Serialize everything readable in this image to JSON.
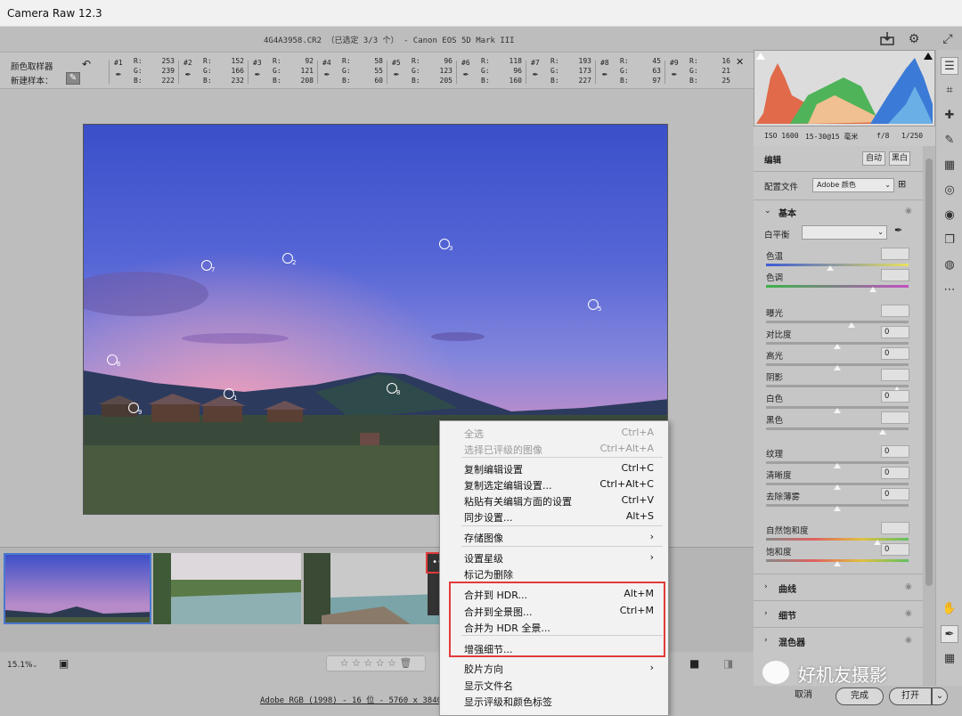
{
  "window": {
    "title": "Camera Raw 12.3"
  },
  "filebar": {
    "info": "4G4A3958.CR2 （已选定 3/3 个） - Canon EOS 5D Mark III"
  },
  "sampler": {
    "label_tool": "颜色取样器",
    "label_new": "新建样本：",
    "samples": [
      {
        "id": "#1",
        "r": "253",
        "g": "239",
        "b": "222"
      },
      {
        "id": "#2",
        "r": "152",
        "g": "166",
        "b": "232"
      },
      {
        "id": "#3",
        "r": "92",
        "g": "121",
        "b": "208"
      },
      {
        "id": "#4",
        "r": "58",
        "g": "55",
        "b": "60"
      },
      {
        "id": "#5",
        "r": "96",
        "g": "123",
        "b": "205"
      },
      {
        "id": "#6",
        "r": "118",
        "g": "96",
        "b": "160"
      },
      {
        "id": "#7",
        "r": "193",
        "g": "173",
        "b": "227"
      },
      {
        "id": "#8",
        "r": "45",
        "g": "63",
        "b": "97"
      },
      {
        "id": "#9",
        "r": "16",
        "g": "21",
        "b": "25"
      }
    ],
    "r_label": "R:",
    "g_label": "G:",
    "b_label": "B:"
  },
  "photo_markers": [
    "1",
    "2",
    "3",
    "4",
    "5",
    "6",
    "7",
    "8",
    "9"
  ],
  "exif": {
    "iso": "ISO 1600",
    "lens": "15-30@15 毫米",
    "aperture": "f/8",
    "shutter": "1/250"
  },
  "panel": {
    "edit": "编辑",
    "auto": "自动",
    "bw": "黑白",
    "profile_label": "配置文件",
    "profile_value": "Adobe 颜色",
    "basic": "基本",
    "wb_label": "白平衡",
    "sliders": [
      {
        "label": "色温",
        "value": ""
      },
      {
        "label": "色调",
        "value": ""
      },
      {
        "label": "曝光",
        "value": ""
      },
      {
        "label": "对比度",
        "value": "0"
      },
      {
        "label": "高光",
        "value": "0"
      },
      {
        "label": "阴影",
        "value": ""
      },
      {
        "label": "白色",
        "value": "0"
      },
      {
        "label": "黑色",
        "value": ""
      },
      {
        "label": "纹理",
        "value": "0"
      },
      {
        "label": "清晰度",
        "value": "0"
      },
      {
        "label": "去除薄雾",
        "value": "0"
      },
      {
        "label": "自然饱和度",
        "value": ""
      },
      {
        "label": "饱和度",
        "value": "0"
      }
    ],
    "curve": "曲线",
    "detail": "细节",
    "mixer": "混色器"
  },
  "menu": {
    "items": [
      {
        "label": "全选",
        "shortcut": "Ctrl+A",
        "disabled": true
      },
      {
        "label": "选择已评级的图像",
        "shortcut": "Ctrl+Alt+A",
        "disabled": true
      },
      {
        "label": "复制编辑设置",
        "shortcut": "Ctrl+C"
      },
      {
        "label": "复制选定编辑设置...",
        "shortcut": "Ctrl+Alt+C"
      },
      {
        "label": "粘贴有关编辑方面的设置",
        "shortcut": "Ctrl+V"
      },
      {
        "label": "同步设置...",
        "shortcut": "Alt+S"
      },
      {
        "label": "存储图像",
        "shortcut": "›"
      },
      {
        "label": "设置星级",
        "shortcut": "›"
      },
      {
        "label": "标记为删除",
        "shortcut": ""
      },
      {
        "label": "合并到 HDR...",
        "shortcut": "Alt+M"
      },
      {
        "label": "合并到全景图...",
        "shortcut": "Ctrl+M"
      },
      {
        "label": "合并为 HDR 全景...",
        "shortcut": ""
      },
      {
        "label": "增强细节...",
        "shortcut": ""
      },
      {
        "label": "胶片方向",
        "shortcut": "›"
      },
      {
        "label": "显示文件名",
        "shortcut": ""
      },
      {
        "label": "显示评级和颜色标签",
        "shortcut": ""
      }
    ]
  },
  "bottom": {
    "zoom": "15.1%",
    "stars": "☆ ☆ ☆ ☆ ☆",
    "footer_link": "Adobe RGB (1998) - 16 位 - 5760 x 3840 (22.1",
    "cancel": "取消",
    "done": "完成",
    "open": "打开"
  },
  "watermark": "好机友摄影"
}
